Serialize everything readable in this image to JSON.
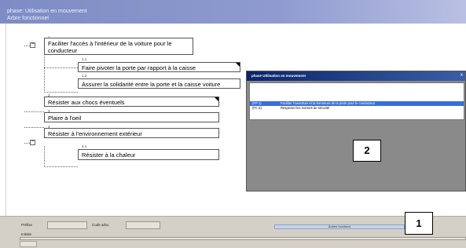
{
  "window": {
    "title_line1": "phase: Utilisation en mouvement",
    "title_line2": "Arbre fonctionnel"
  },
  "tree": {
    "nodes": [
      {
        "num": "1",
        "label_line1": "Faciliter l'accès à l'intérieur de la voiture pour le",
        "label_line2": "conducteur"
      },
      {
        "num": "1.1",
        "label": "Faire pivoter la porte par rapport à la caisse"
      },
      {
        "num": "1.2",
        "label": "Assurer la solidarité entre la porte et la caisse voiture"
      },
      {
        "num": "2",
        "label": "Résister aux chocs éventuels"
      },
      {
        "num": "3",
        "label": "Plaire à l'oeil"
      },
      {
        "num": "4",
        "label": "Résister à l'environnement extérieur"
      },
      {
        "num": "4.1",
        "label": "Résister à la chaleur"
      }
    ],
    "expander_symbol": "−"
  },
  "dialog": {
    "title": "phase Utilisation en mouvement",
    "close": "x",
    "rows": [
      {
        "code": "(FP 1)",
        "text": "Faciliter l'ouverture et la fermeture de la porte pour le conducteur"
      },
      {
        "code": "(FC 5)",
        "text": "Respecter les normes de sécurité"
      }
    ]
  },
  "callouts": {
    "one": "1",
    "two": "2"
  },
  "footer": {
    "prefix_label": "Préfixe",
    "code_label": "Code arbo.",
    "initial_label": "Initiale",
    "button_label": "Autres fonctions"
  },
  "colors": {
    "titlebar": "#8f9bd0",
    "dialog_title": "#0a246a",
    "selected_row": "#3a6fd8",
    "footer": "#d4d0c8"
  }
}
